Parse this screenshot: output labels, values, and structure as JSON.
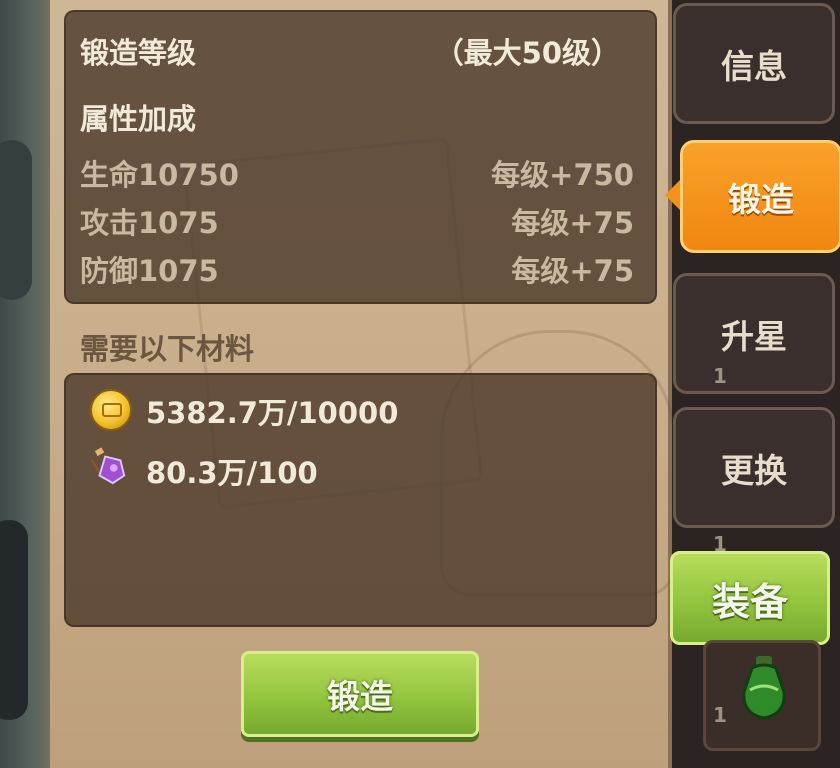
{
  "stats_panel": {
    "title": "锻造等级",
    "max_level": "（最大50级）",
    "bonus_header": "属性加成",
    "stats": [
      {
        "name": "生命10750",
        "increment": "每级+750"
      },
      {
        "name": "攻击1075",
        "increment": "每级+75"
      },
      {
        "name": "防御1075",
        "increment": "每级+75"
      }
    ]
  },
  "materials": {
    "header": "需要以下材料",
    "items": [
      {
        "icon": "gold-coin-icon",
        "amount": "5382.7万/10000"
      },
      {
        "icon": "purple-potion-icon",
        "amount": "80.3万/100"
      }
    ]
  },
  "forge_button": "锻造",
  "tabs": [
    {
      "label": "信息"
    },
    {
      "label": "锻造",
      "active": true
    },
    {
      "label": "升星"
    },
    {
      "label": "更换"
    }
  ],
  "equip_button": "装备",
  "slot_counts": [
    "1",
    "1",
    "1"
  ],
  "colors": {
    "active_tab": "#f08710",
    "green_button": "#8fc23c",
    "panel_bg": "#c8ae8a"
  }
}
